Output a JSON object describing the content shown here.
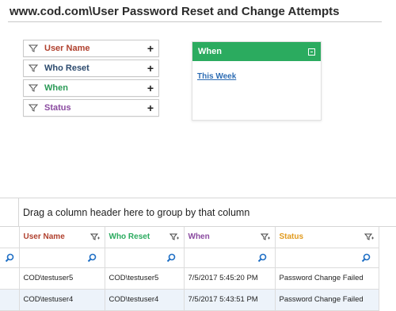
{
  "page": {
    "title": "www.cod.com\\User Password Reset and Change Attempts"
  },
  "filters": [
    {
      "label": "User Name",
      "color": "#b0402e"
    },
    {
      "label": "Who Reset",
      "color": "#2c4a6e"
    },
    {
      "label": "When",
      "color": "#2a9a56"
    },
    {
      "label": "Status",
      "color": "#8a4aa0"
    }
  ],
  "when_panel": {
    "title": "When",
    "link": "This Week",
    "accent": "#2bab5f"
  },
  "grid": {
    "group_hint": "Drag a column header here to group by that column",
    "columns": [
      {
        "label": "User Name",
        "color": "#b0402e"
      },
      {
        "label": "Who Reset",
        "color": "#2bab5f"
      },
      {
        "label": "When",
        "color": "#8a4aa0"
      },
      {
        "label": "Status",
        "color": "#e19a1d"
      }
    ],
    "rows": [
      [
        "COD\\testuser5",
        "COD\\testuser5",
        "7/5/2017 5:45:20 PM",
        "Password Change Failed"
      ],
      [
        "COD\\testuser4",
        "COD\\testuser4",
        "7/5/2017 5:43:51 PM",
        "Password Change Failed"
      ]
    ]
  },
  "icons": {
    "filter": "funnel-icon",
    "add": "plus-icon",
    "search": "magnifier-icon",
    "collapse": "collapse-icon"
  }
}
